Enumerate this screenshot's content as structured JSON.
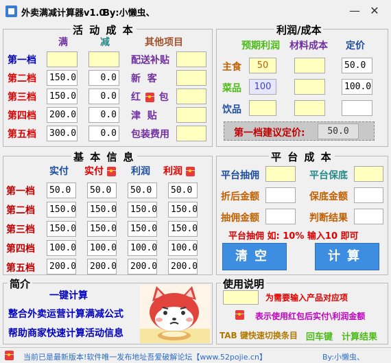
{
  "window": {
    "title": "外卖满减计算器v1.0",
    "by": "By:小懒虫、",
    "minimize": "—",
    "close": "✕"
  },
  "activity": {
    "title": "活 动 成 本",
    "col_full": "满",
    "col_minus": "减",
    "col_other": "其他项目",
    "tiers": [
      {
        "label": "第一档",
        "full": "",
        "minus": ""
      },
      {
        "label": "第二档",
        "full": "150.0",
        "minus": "0.0"
      },
      {
        "label": "第三档",
        "full": "150.0",
        "minus": "0.0"
      },
      {
        "label": "第四档",
        "full": "200.0",
        "minus": "0.0"
      },
      {
        "label": "第五档",
        "full": "300.0",
        "minus": "0.0"
      }
    ],
    "other_items": [
      {
        "label": "配送补贴",
        "value": ""
      },
      {
        "label": "新  客",
        "value": ""
      },
      {
        "label_a": "红",
        "label_b": "包",
        "value": ""
      },
      {
        "label": "津  贴",
        "value": ""
      },
      {
        "label": "包装费用",
        "value": ""
      }
    ]
  },
  "profit": {
    "title": "利润/成本",
    "col_expected": "预期利润",
    "col_material": "材料成本",
    "col_price": "定价",
    "rows": [
      {
        "label": "主食",
        "expected": "50",
        "material": "",
        "price": "50.0"
      },
      {
        "label": "菜品",
        "expected": "100",
        "material": "",
        "price": "100.0"
      },
      {
        "label": "饮品",
        "expected": "",
        "material": "",
        "price": ""
      }
    ],
    "suggest_label": "第一档建议定价:",
    "suggest_value": "50.0"
  },
  "basic": {
    "title": "基 本 信 息",
    "col_actual": "实付",
    "col_actual_rp": "实付",
    "col_profit": "利润",
    "col_profit_rp": "利润",
    "rows": [
      {
        "label": "第一档",
        "v": [
          "50.0",
          "50.0",
          "50.0",
          "50.0"
        ]
      },
      {
        "label": "第二档",
        "v": [
          "150.0",
          "150.0",
          "150.0",
          "150.0"
        ]
      },
      {
        "label": "第三档",
        "v": [
          "150.0",
          "150.0",
          "150.0",
          "150.0"
        ]
      },
      {
        "label": "第四档",
        "v": [
          "100.0",
          "100.0",
          "100.0",
          "100.0"
        ]
      },
      {
        "label": "第五档",
        "v": [
          "200.0",
          "200.0",
          "200.0",
          "200.0"
        ]
      }
    ]
  },
  "platform": {
    "title": "平 台 成 本",
    "commission_label": "平台抽佣",
    "guarantee_label": "平台保底",
    "discount_label": "折后金额",
    "guarantee_amount_label": "保底金额",
    "commission_amount_label": "抽佣金额",
    "result_label": "判断结果",
    "hint": "平台抽佣 如: 10% 输入10 即可",
    "clear_btn": "清空",
    "calc_btn": "计算"
  },
  "intro": {
    "title": "简介",
    "line1": "一键计算",
    "line2": "整合外卖运营计算满减公式",
    "line3": "帮助商家快速计算活动信息"
  },
  "usage": {
    "title": "使用说明",
    "line1": "为需要输入产品对应项",
    "line2": "表示使用红包后实付\\利润金额",
    "line3_a": "TAB 键快速切换条目",
    "line3_b": "回车键",
    "line3_c": "计算结果"
  },
  "status": {
    "text": "当前已是最新版本!软件唯一发布地址吾爱破解论坛【www.52pojie.cn】",
    "by": "By:小懒虫、"
  },
  "colors": {
    "accent_blue": "#3d8de0",
    "input_yellow": "#ffffc0",
    "label_red": "#e00000"
  }
}
